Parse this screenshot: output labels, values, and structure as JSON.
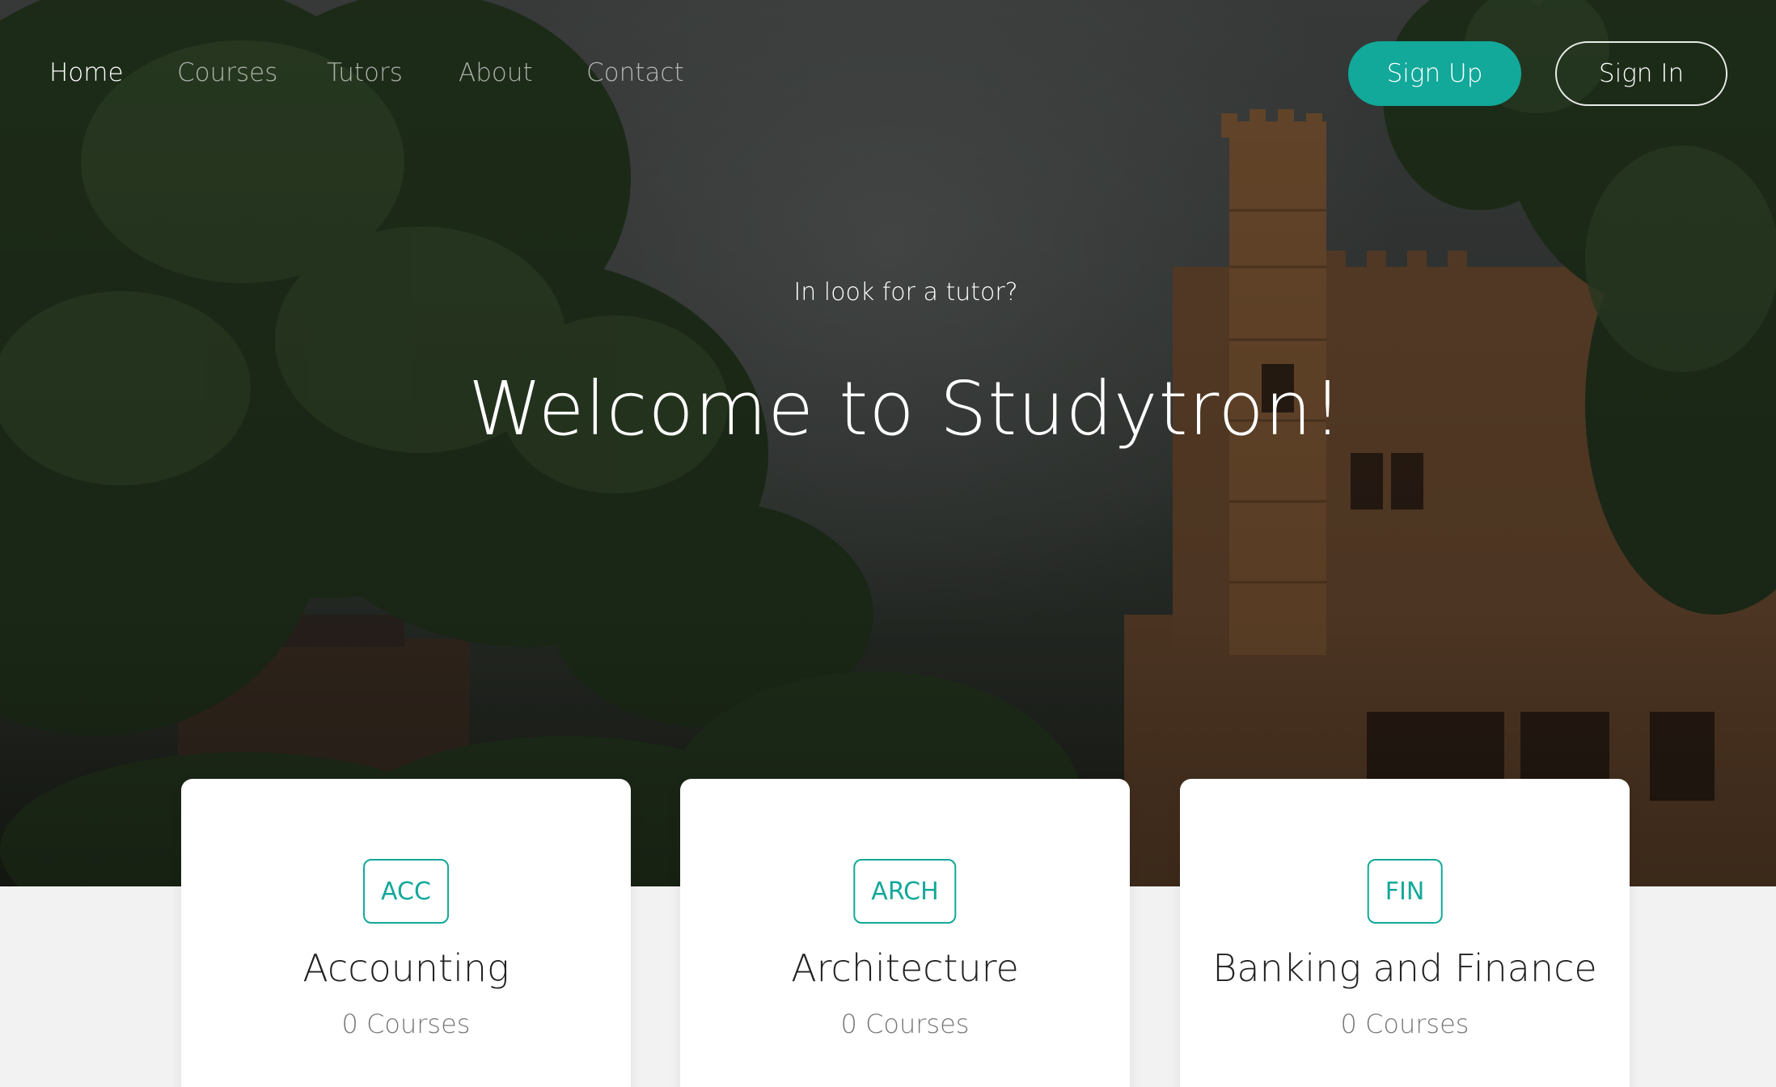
{
  "nav": {
    "links": [
      {
        "label": "Home",
        "active": true
      },
      {
        "label": "Courses",
        "active": false
      },
      {
        "label": "Tutors",
        "active": false
      },
      {
        "label": "About",
        "active": false
      },
      {
        "label": "Contact",
        "active": false
      }
    ],
    "sign_up_label": "Sign Up",
    "sign_in_label": "Sign In"
  },
  "hero": {
    "tagline": "In look for a tutor?",
    "headline": "Welcome to Studytron!"
  },
  "categories": [
    {
      "code": "ACC",
      "name": "Accounting",
      "courses": "0 Courses"
    },
    {
      "code": "ARCH",
      "name": "Architecture",
      "courses": "0 Courses"
    },
    {
      "code": "FIN",
      "name": "Banking and Finance",
      "courses": "0 Courses"
    }
  ],
  "colors": {
    "accent": "#12a89a",
    "hero_overlay": "#3b3e3d",
    "page_background": "#f2f2f2",
    "card_background": "#ffffff"
  }
}
